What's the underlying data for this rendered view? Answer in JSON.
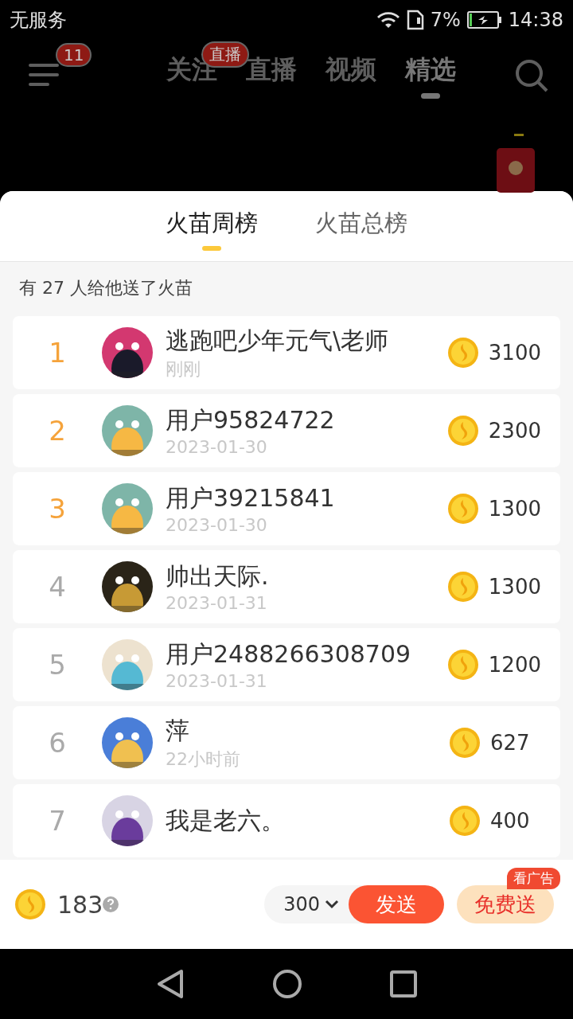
{
  "status_bar": {
    "carrier": "无服务",
    "battery": "7%",
    "time": "14:38"
  },
  "top_nav": {
    "menu_badge": "11",
    "tabs": [
      {
        "label": "关注",
        "selected": false,
        "badge": "直播"
      },
      {
        "label": "直播",
        "selected": false
      },
      {
        "label": "视频",
        "selected": false
      },
      {
        "label": "精选",
        "selected": true
      }
    ]
  },
  "sheet": {
    "tabs": [
      {
        "label": "火苗周榜",
        "selected": true
      },
      {
        "label": "火苗总榜",
        "selected": false
      }
    ],
    "summary": "有 27 人给他送了火苗",
    "rows": [
      {
        "rank": "1",
        "top": true,
        "name": "逃跑吧少年元气\\老师",
        "time": "刚刚",
        "amount": "3100"
      },
      {
        "rank": "2",
        "top": true,
        "name": "用户95824722",
        "time": "2023-01-30",
        "amount": "2300"
      },
      {
        "rank": "3",
        "top": true,
        "name": "用户39215841",
        "time": "2023-01-30",
        "amount": "1300"
      },
      {
        "rank": "4",
        "top": false,
        "name": "帅出天际.",
        "time": "2023-01-31",
        "amount": "1300"
      },
      {
        "rank": "5",
        "top": false,
        "name": "用户2488266308709",
        "time": "2023-01-31",
        "amount": "1200"
      },
      {
        "rank": "6",
        "top": false,
        "name": "萍",
        "time": "22小时前",
        "amount": "627"
      },
      {
        "rank": "7",
        "top": false,
        "name": "我是老六。",
        "amount": "400"
      }
    ]
  },
  "bottom_bar": {
    "balance": "183",
    "amount": "300",
    "send": "发送",
    "free_send": "免费送",
    "free_badge": "看广告"
  }
}
